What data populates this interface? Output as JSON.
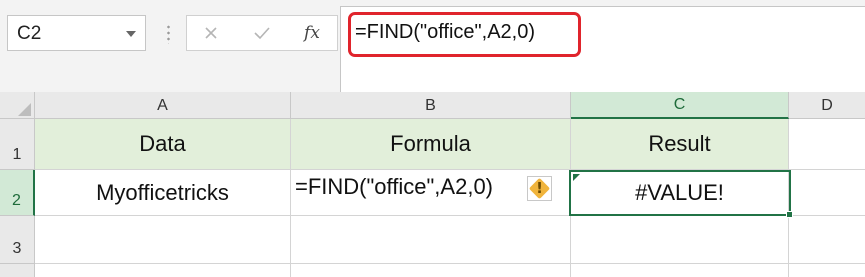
{
  "name_box": {
    "value": "C2"
  },
  "formula_bar": {
    "formula": "=FIND(\"office\",A2,0)",
    "fx_label": "fx"
  },
  "columns": [
    "A",
    "B",
    "C",
    "D"
  ],
  "active_column": "C",
  "rows": [
    "1",
    "2",
    "3"
  ],
  "active_row": "2",
  "cells": {
    "A1": "Data",
    "B1": "Formula",
    "C1": "Result",
    "A2": "Myofficetricks",
    "B2": "=FIND(\"office\",A2,0)",
    "C2": "#VALUE!"
  },
  "icons": {
    "cancel": "close-icon",
    "enter": "checkmark-icon",
    "insert_function": "fx-icon",
    "error_warning": "warning-icon"
  },
  "colors": {
    "header_fill": "#e2efda",
    "active_accent": "#217346",
    "highlight_border": "#e0242c",
    "warning": "#f0b43c"
  }
}
